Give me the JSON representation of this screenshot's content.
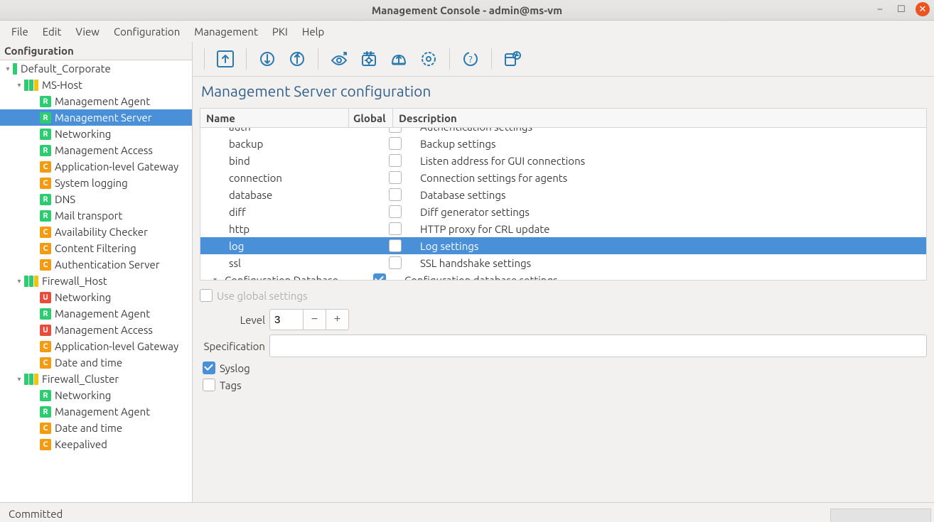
{
  "window": {
    "title": "Management Console - admin@ms-vm"
  },
  "menu": [
    "File",
    "Edit",
    "View",
    "Configuration",
    "Management",
    "PKI",
    "Help"
  ],
  "sidebar": {
    "header": "Configuration",
    "tree": [
      {
        "level": 0,
        "expander": "▾",
        "kind": "site",
        "label": "Default_Corporate"
      },
      {
        "level": 1,
        "expander": "▾",
        "kind": "host",
        "label": "MS-Host"
      },
      {
        "level": 2,
        "kind": "comp",
        "badge": "R",
        "label": "Management Agent"
      },
      {
        "level": 2,
        "kind": "comp",
        "badge": "R",
        "label": "Management Server",
        "selected": true
      },
      {
        "level": 2,
        "kind": "comp",
        "badge": "R",
        "label": "Networking"
      },
      {
        "level": 2,
        "kind": "comp",
        "badge": "R",
        "label": "Management Access"
      },
      {
        "level": 2,
        "kind": "comp",
        "badge": "C",
        "label": "Application-level Gateway"
      },
      {
        "level": 2,
        "kind": "comp",
        "badge": "C",
        "label": "System logging"
      },
      {
        "level": 2,
        "kind": "comp",
        "badge": "R",
        "label": "DNS"
      },
      {
        "level": 2,
        "kind": "comp",
        "badge": "R",
        "label": "Mail transport"
      },
      {
        "level": 2,
        "kind": "comp",
        "badge": "C",
        "label": "Availability Checker"
      },
      {
        "level": 2,
        "kind": "comp",
        "badge": "C",
        "label": "Content Filtering"
      },
      {
        "level": 2,
        "kind": "comp",
        "badge": "C",
        "label": "Authentication Server"
      },
      {
        "level": 1,
        "expander": "▾",
        "kind": "host",
        "label": "Firewall_Host"
      },
      {
        "level": 2,
        "kind": "comp",
        "badge": "U",
        "label": "Networking"
      },
      {
        "level": 2,
        "kind": "comp",
        "badge": "R",
        "label": "Management Agent"
      },
      {
        "level": 2,
        "kind": "comp",
        "badge": "U",
        "label": "Management Access"
      },
      {
        "level": 2,
        "kind": "comp",
        "badge": "C",
        "label": "Application-level Gateway"
      },
      {
        "level": 2,
        "kind": "comp",
        "badge": "C",
        "label": "Date and time"
      },
      {
        "level": 1,
        "expander": "▾",
        "kind": "host",
        "label": "Firewall_Cluster"
      },
      {
        "level": 2,
        "kind": "comp",
        "badge": "R",
        "label": "Networking"
      },
      {
        "level": 2,
        "kind": "comp",
        "badge": "R",
        "label": "Management Agent"
      },
      {
        "level": 2,
        "kind": "comp",
        "badge": "C",
        "label": "Date and time"
      },
      {
        "level": 2,
        "kind": "comp",
        "badge": "C",
        "label": "Keepalived"
      }
    ]
  },
  "main": {
    "heading": "Management Server configuration",
    "columns": {
      "name": "Name",
      "global": "Global",
      "desc": "Description"
    },
    "rows": [
      {
        "name": "auth",
        "global": false,
        "desc": "Authentication settings",
        "cut": true
      },
      {
        "name": "backup",
        "global": false,
        "desc": "Backup settings"
      },
      {
        "name": "bind",
        "global": false,
        "desc": "Listen address for GUI connections"
      },
      {
        "name": "connection",
        "global": false,
        "desc": "Connection settings for agents"
      },
      {
        "name": "database",
        "global": false,
        "desc": "Database settings"
      },
      {
        "name": "diff",
        "global": false,
        "desc": "Diff generator settings"
      },
      {
        "name": "http",
        "global": false,
        "desc": "HTTP proxy for CRL update"
      },
      {
        "name": "log",
        "global": false,
        "desc": "Log settings",
        "selected": true
      },
      {
        "name": "ssl",
        "global": false,
        "desc": "SSL handshake settings"
      },
      {
        "name": "Configuration Database",
        "global": true,
        "desc": "Configuration database settings",
        "group": true
      }
    ],
    "use_global_label": "Use global settings",
    "form": {
      "level_label": "Level",
      "level_value": "3",
      "spec_label": "Specification",
      "syslog_label": "Syslog",
      "syslog_checked": true,
      "tags_label": "Tags",
      "tags_checked": false
    }
  },
  "status": {
    "text": "Committed"
  }
}
